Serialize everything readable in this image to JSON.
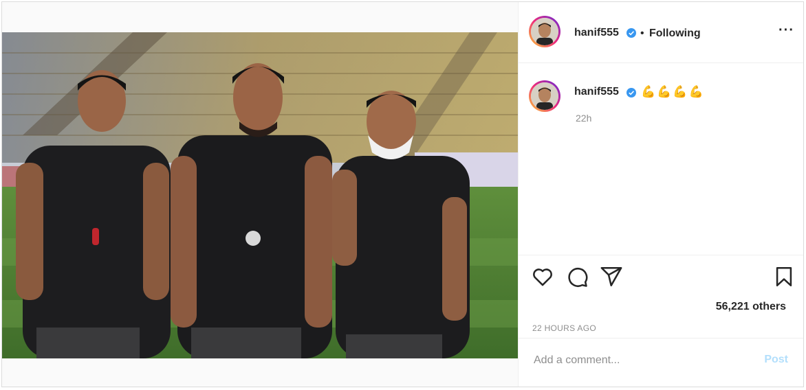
{
  "post": {
    "image_alt": "Three men in black training shirts standing on a football pitch",
    "author": {
      "username": "hanif555",
      "verified": true,
      "follow_status": "Following"
    },
    "separator": "•",
    "caption": {
      "username": "hanif555",
      "emoji": "💪💪💪💪",
      "time": "22h"
    },
    "likes": "56,221 others",
    "time_ago": "22 HOURS AGO",
    "comment": {
      "placeholder": "Add a comment...",
      "post_label": "Post"
    }
  },
  "icons": [
    "more-options-icon",
    "verified-badge-icon",
    "heart-icon",
    "comment-icon",
    "share-icon",
    "bookmark-icon"
  ],
  "colors": {
    "verified_blue": "#3897f0",
    "post_button_disabled": "#b2dffc",
    "secondary_text": "#8e8e8e"
  }
}
